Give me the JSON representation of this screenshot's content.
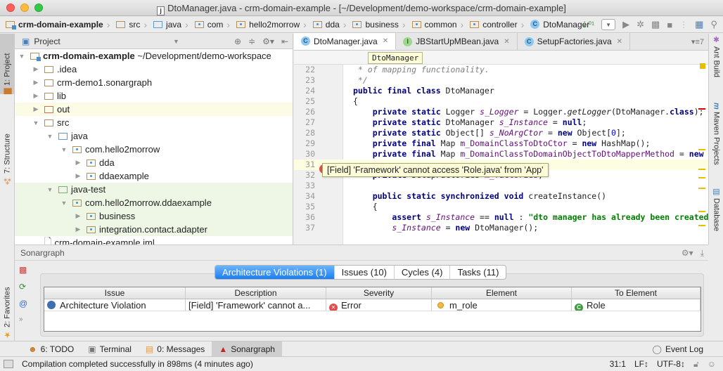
{
  "window": {
    "title": "DtoManager.java - crm-domain-example - [~/Development/demo-workspace/crm-domain-example]"
  },
  "navbar": {
    "crumbs": [
      "crm-domain-example",
      "src",
      "java",
      "com",
      "hello2morrow",
      "dda",
      "business",
      "common",
      "controller",
      "DtoManager"
    ]
  },
  "toolbar": {
    "make_icon": "make-icon",
    "run_icon": "run-icon",
    "debug_icon": "debug-icon",
    "coverage_icon": "coverage-icon",
    "stop_icon": "stop-icon",
    "structure_icon": "project-structure-icon",
    "search_icon": "search-icon"
  },
  "left_strip": {
    "project": "1: Project",
    "structure": "7: Structure",
    "favorites": "2: Favorites"
  },
  "right_strip": {
    "ant": "Ant Build",
    "maven": "Maven Projects",
    "database": "Database"
  },
  "project": {
    "header": "Project",
    "tree": [
      {
        "label": "crm-domain-example",
        "suffix": " ~/Development/demo-workspace",
        "depth": 0,
        "expanded": true,
        "icon": "module",
        "bold": true
      },
      {
        "label": ".idea",
        "depth": 1,
        "expanded": false,
        "icon": "folder"
      },
      {
        "label": "crm-demo1.sonargraph",
        "depth": 1,
        "expanded": false,
        "icon": "folder"
      },
      {
        "label": "lib",
        "depth": 1,
        "expanded": false,
        "icon": "folder"
      },
      {
        "label": "out",
        "depth": 1,
        "expanded": false,
        "icon": "excluded",
        "highlight": "yellow"
      },
      {
        "label": "src",
        "depth": 1,
        "expanded": true,
        "icon": "folder"
      },
      {
        "label": "java",
        "depth": 2,
        "expanded": true,
        "icon": "source"
      },
      {
        "label": "com.hello2morrow",
        "depth": 3,
        "expanded": true,
        "icon": "package"
      },
      {
        "label": "dda",
        "depth": 4,
        "expanded": false,
        "icon": "package"
      },
      {
        "label": "ddaexample",
        "depth": 4,
        "expanded": false,
        "icon": "package"
      },
      {
        "label": "java-test",
        "depth": 2,
        "expanded": true,
        "icon": "test",
        "highlight": "green"
      },
      {
        "label": "com.hello2morrow.ddaexample",
        "depth": 3,
        "expanded": true,
        "icon": "package",
        "highlight": "green"
      },
      {
        "label": "business",
        "depth": 4,
        "expanded": false,
        "icon": "package",
        "highlight": "green"
      },
      {
        "label": "integration.contact.adapter",
        "depth": 4,
        "expanded": false,
        "icon": "package",
        "highlight": "green"
      },
      {
        "label": "crm-domain-example.iml",
        "depth": 1,
        "icon": "file"
      }
    ]
  },
  "editor": {
    "tabs": [
      {
        "label": "DtoManager.java",
        "type": "class",
        "active": true
      },
      {
        "label": "JBStartUpMBean.java",
        "type": "interface",
        "active": false
      },
      {
        "label": "SetupFactories.java",
        "type": "class",
        "active": false
      }
    ],
    "tabs_more": "7",
    "breadcrumb_tooltip": "DtoManager",
    "lines": [
      {
        "n": "22",
        "html": "<span class='cm'> * of mapping functionality.</span>"
      },
      {
        "n": "23",
        "html": "<span class='cm'> */</span>"
      },
      {
        "n": "24",
        "html": "<span class='kw'>public final class</span> DtoManager"
      },
      {
        "n": "25",
        "html": "{"
      },
      {
        "n": "26",
        "html": "    <span class='kw'>private static</span> Logger <span class='fi'>s_Logger</span> = Logger.<i>getLogger</i>(DtoManager.<span class='kw'>class</span>);"
      },
      {
        "n": "27",
        "html": "    <span class='kw'>private static</span> DtoManager <span class='fi'>s_Instance</span> = <span class='kw'>null</span>;"
      },
      {
        "n": "28",
        "html": "    <span class='kw'>private static</span> Object[] <span class='fi'>s_NoArgCtor</span> = <span class='kw'>new</span> Object[<span class='nm'>0</span>];"
      },
      {
        "n": "29",
        "html": "    <span class='kw'>private final</span> Map <span class='fi' style='font-style:normal;color:#660e7a'>m_DomainClassToDtoCtor</span> = <span class='kw'>new</span> HashMap();"
      },
      {
        "n": "30",
        "html": "    <span class='kw'>private final</span> Map <span style='color:#660e7a'>m_DomainClassToDomainObjectToDtoMapperMethod</span> = <span class='kw'>new</span>"
      },
      {
        "n": "31",
        "html": "",
        "hl": true
      },
      {
        "n": "32",
        "html": "    <span class='kw'>private</span> SetupFactories <span style='color:#660e7a'>m_factories</span>;"
      },
      {
        "n": "33",
        "html": ""
      },
      {
        "n": "34",
        "html": "    <span class='kw'>public static synchronized void</span> createInstance()"
      },
      {
        "n": "35",
        "html": "    {"
      },
      {
        "n": "36",
        "html": "        <span class='kw'>assert</span> <span class='fi'>s_Instance</span> == <span class='kw'>null</span> : <span class='st'>\"dto manager has already been created\"</span>"
      },
      {
        "n": "37",
        "html": "        <span class='fi'>s_Instance</span> = <span class='kw'>new</span> DtoManager();"
      }
    ],
    "error_tooltip": "[Field] 'Framework' cannot access 'Role.java' from 'App'"
  },
  "sonargraph": {
    "title": "Sonargraph",
    "tabs": [
      {
        "label": "Architecture Violations (1)",
        "active": true
      },
      {
        "label": "Issues (10)",
        "active": false
      },
      {
        "label": "Cycles (4)",
        "active": false
      },
      {
        "label": "Tasks (11)",
        "active": false
      }
    ],
    "columns": [
      "Issue",
      "Description",
      "Severity",
      "Element",
      "To Element"
    ],
    "rows": [
      {
        "issue": "Architecture Violation",
        "description": "[Field] 'Framework' cannot a...",
        "severity": "Error",
        "element": "m_role",
        "to_element": "Role"
      }
    ]
  },
  "tool_windows": [
    {
      "label": "6: TODO",
      "active": false
    },
    {
      "label": "Terminal",
      "active": false
    },
    {
      "label": "0: Messages",
      "active": false
    },
    {
      "label": "Sonargraph",
      "active": true
    }
  ],
  "event_log": "Event Log",
  "status": {
    "message": "Compilation completed successfully in 898ms (4 minutes ago)",
    "position": "31:1",
    "line_sep": "LF↕",
    "encoding": "UTF-8↕"
  }
}
